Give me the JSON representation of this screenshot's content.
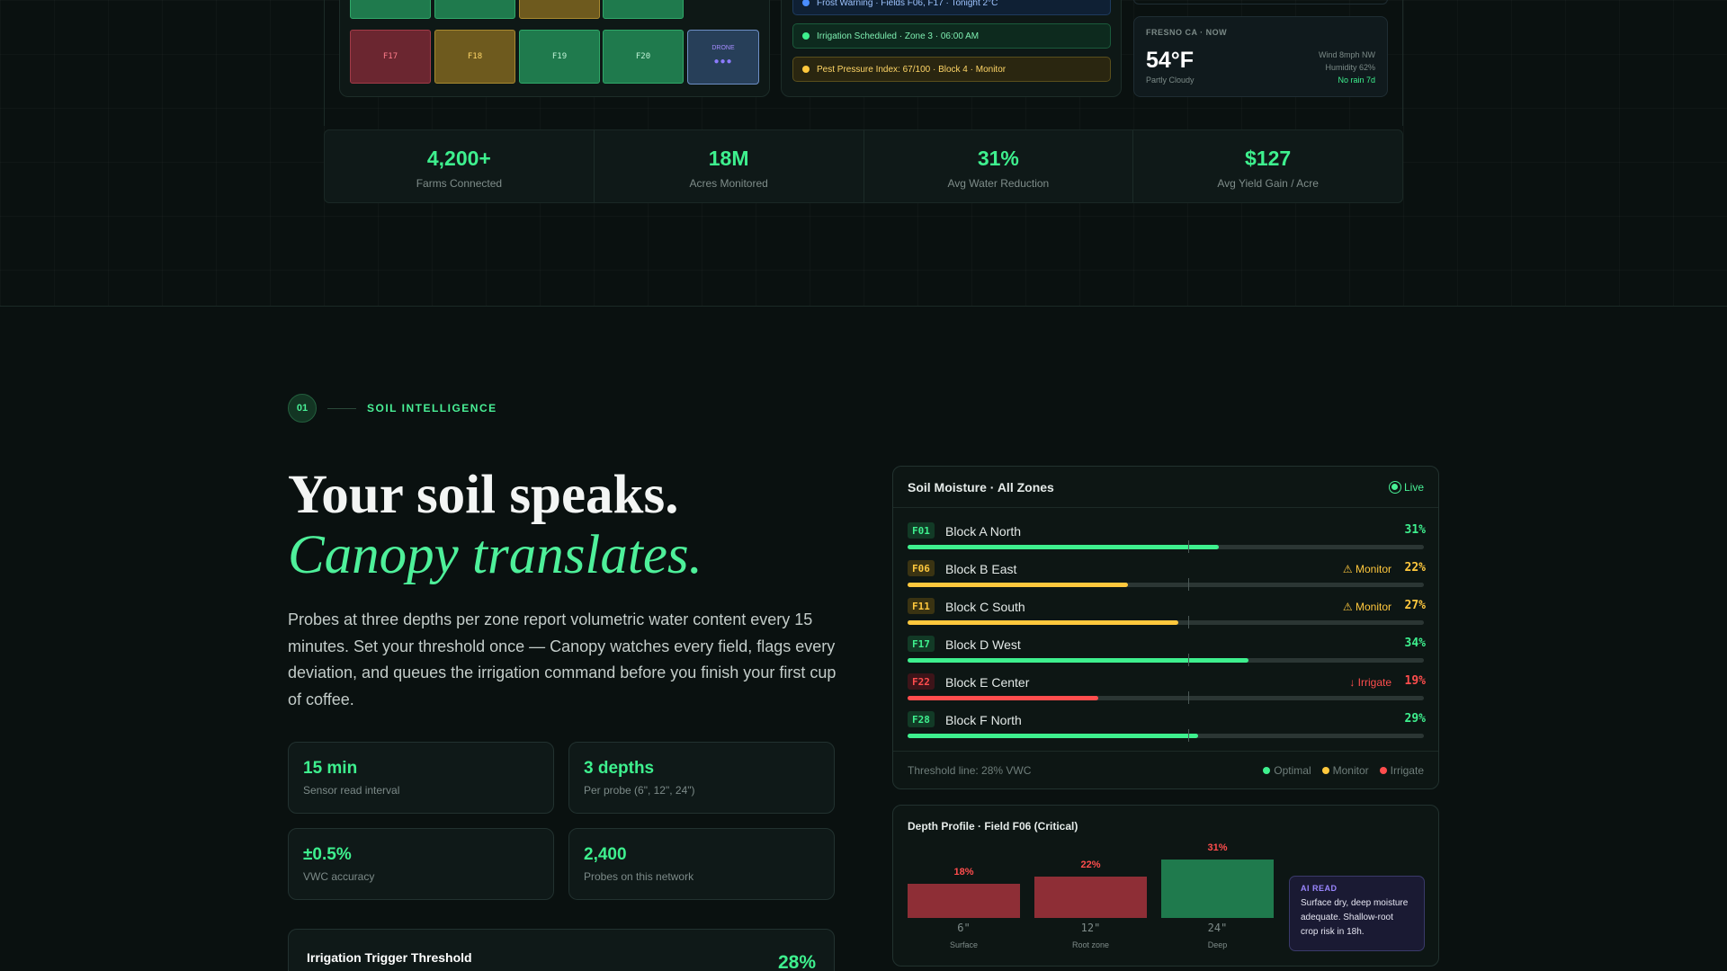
{
  "dashboard": {
    "field_plots": [
      {
        "label": "",
        "status": "green"
      },
      {
        "label": "",
        "status": "green"
      },
      {
        "label": "",
        "status": "yellow"
      },
      {
        "label": "",
        "status": "green"
      },
      {
        "label": "F17",
        "status": "red"
      },
      {
        "label": "F18",
        "status": "yellow"
      },
      {
        "label": "F19",
        "status": "green"
      },
      {
        "label": "F20",
        "status": "green"
      }
    ],
    "drone_label": "DRONE",
    "drone_dots": "●●●",
    "alerts": [
      {
        "text": "Frost Warning · Fields F06, F17 · Tonight 2°C",
        "type": "blue",
        "color": "#4a8dff"
      },
      {
        "text": "Irrigation Scheduled · Zone 3 · 06:00 AM",
        "type": "green",
        "color": "#3ef08e"
      },
      {
        "text": "Pest Pressure Index: 67/100 · Block 4 · Monitor",
        "type": "yellow",
        "color": "#ffc83d"
      }
    ],
    "weather": {
      "location": "FRESNO CA · NOW",
      "temp": "54°F",
      "condition": "Partly Cloudy",
      "wind": "Wind 8mph NW",
      "humidity": "Humidity 62%",
      "rain": "No rain 7d"
    }
  },
  "stats": [
    {
      "value": "4,200+",
      "label": "Farms Connected"
    },
    {
      "value": "18M",
      "label": "Acres Monitored"
    },
    {
      "value": "31%",
      "label": "Avg Water Reduction"
    },
    {
      "value": "$127",
      "label": "Avg Yield Gain / Acre"
    }
  ],
  "section": {
    "number": "01",
    "label": "SOIL INTELLIGENCE",
    "headline": "Your soil speaks.",
    "headline_em": "Canopy translates.",
    "lede": "Probes at three depths per zone report volumetric water content every 15 minutes. Set your threshold once — Canopy watches every field, flags every deviation, and queues the irrigation command before you finish your first cup of coffee."
  },
  "mini_stats": [
    {
      "value": "15 min",
      "label": "Sensor read interval"
    },
    {
      "value": "3 depths",
      "label": "Per probe (6\", 12\", 24\")"
    },
    {
      "value": "±0.5%",
      "label": "VWC accuracy"
    },
    {
      "value": "2,400",
      "label": "Probes on this network"
    }
  ],
  "trigger": {
    "title": "Irrigation Trigger Threshold",
    "value": "28%"
  },
  "moisture_panel": {
    "title": "Soil Moisture · All Zones",
    "live_label": "Live",
    "threshold_value": 28,
    "zones": [
      {
        "code": "F01",
        "name": "Block A North",
        "status": "",
        "pct_label": "31%",
        "value": 31,
        "level": "optimal"
      },
      {
        "code": "F06",
        "name": "Block B East",
        "status": "⚠ Monitor",
        "pct_label": "22%",
        "value": 22,
        "level": "monitor"
      },
      {
        "code": "F11",
        "name": "Block C South",
        "status": "⚠ Monitor",
        "pct_label": "27%",
        "value": 27,
        "level": "monitor"
      },
      {
        "code": "F17",
        "name": "Block D West",
        "status": "",
        "pct_label": "34%",
        "value": 34,
        "level": "optimal"
      },
      {
        "code": "F22",
        "name": "Block E Center",
        "status": "↓ Irrigate",
        "pct_label": "19%",
        "value": 19,
        "level": "irrigate"
      },
      {
        "code": "F28",
        "name": "Block F North",
        "status": "",
        "pct_label": "29%",
        "value": 29,
        "level": "optimal"
      }
    ],
    "footer": "Threshold line: 28% VWC",
    "legend": [
      {
        "label": "Optimal",
        "color": "#3ef08e"
      },
      {
        "label": "Monitor",
        "color": "#ffc83d"
      },
      {
        "label": "Irrigate",
        "color": "#ff4d4d"
      }
    ]
  },
  "colors": {
    "optimal": "#3ef08e",
    "monitor": "#ffc83d",
    "irrigate": "#ff4d4d",
    "optimal_bg": "#123a26",
    "monitor_bg": "#3a3312",
    "irrigate_bg": "#3d1419"
  },
  "depth_profile": {
    "title": "Depth Profile · Field F06 (Critical)",
    "bars": [
      {
        "pct_label": "18%",
        "value": 18,
        "depth": "6\"",
        "label": "Surface",
        "status": "dry"
      },
      {
        "pct_label": "22%",
        "value": 22,
        "depth": "12\"",
        "label": "Root zone",
        "status": "dry"
      },
      {
        "pct_label": "31%",
        "value": 31,
        "depth": "24\"",
        "label": "Deep",
        "status": "ok"
      }
    ],
    "ai_tag": "AI READ",
    "ai_text": "Surface dry, deep moisture adequate. Shallow-root crop risk in 18h."
  }
}
